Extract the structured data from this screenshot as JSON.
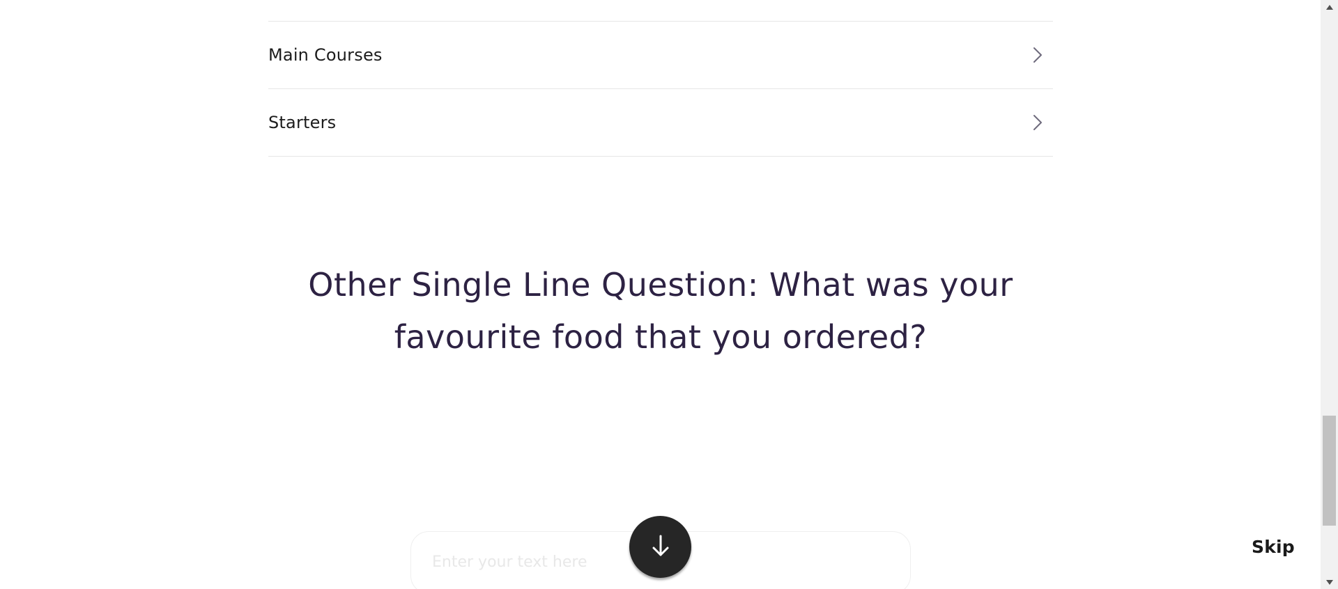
{
  "categories": [
    {
      "label": "Main Courses"
    },
    {
      "label": "Starters"
    }
  ],
  "question": {
    "text": "Other Single Line Question: What was your favourite food that you ordered?"
  },
  "answer_input": {
    "placeholder": "Enter your text here",
    "value": ""
  },
  "actions": {
    "skip_label": "Skip"
  },
  "icons": {
    "row_chevron": "chevron-right-icon",
    "scroll_down": "arrow-down-icon",
    "scrollbar_up": "triangle-up-icon",
    "scrollbar_down": "triangle-down-icon"
  },
  "colors": {
    "question_text": "#2d2243",
    "category_text": "#1c1c1c",
    "chevron": "#6e6a7c",
    "divider": "#e6e6e6",
    "scroll_button": "#262626",
    "skip_text": "#1a1a1a"
  }
}
